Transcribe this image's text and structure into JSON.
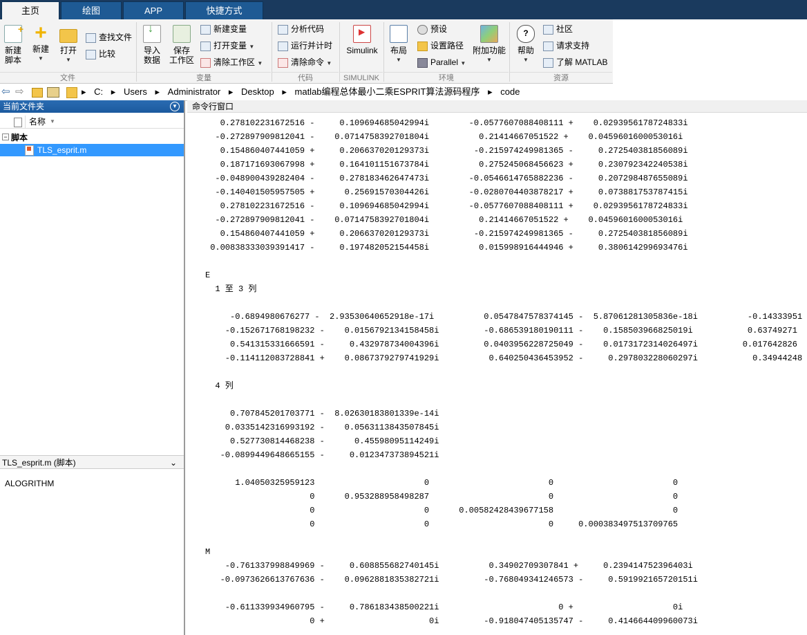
{
  "tabs": [
    "主页",
    "绘图",
    "APP",
    "快捷方式"
  ],
  "ribbon": {
    "file": {
      "new_script": "新建\n脚本",
      "new": "新建",
      "open": "打开",
      "find_files": "查找文件",
      "compare": "比较",
      "group": "文件"
    },
    "variable": {
      "import": "导入\n数据",
      "save_ws": "保存\n工作区",
      "new_var": "新建变量",
      "open_var": "打开变量",
      "clear_ws": "清除工作区",
      "group": "变量"
    },
    "code": {
      "analyze": "分析代码",
      "run_time": "运行并计时",
      "clear_cmd": "清除命令",
      "group": "代码"
    },
    "simulink": {
      "simulink": "Simulink",
      "group": "SIMULINK"
    },
    "env": {
      "layout": "布局",
      "prefs": "预设",
      "set_path": "设置路径",
      "parallel": "Parallel",
      "addons": "附加功能",
      "group": "环境"
    },
    "resources": {
      "help": "帮助",
      "community": "社区",
      "support": "请求支持",
      "learn": "了解 MATLAB",
      "group": "资源"
    }
  },
  "address": {
    "path": [
      "C:",
      "Users",
      "Administrator",
      "Desktop",
      "matlab编程总体最小二乘ESPRIT算法源码程序",
      "code"
    ]
  },
  "left": {
    "title": "当前文件夹",
    "col_name": "名称",
    "folder": "脚本",
    "file": "TLS_esprit.m",
    "details_title": "TLS_esprit.m  (脚本)",
    "details_body": "ALOGRITHM"
  },
  "command": {
    "title": "命令行窗口",
    "lines": [
      "   0.278102231672516 -     0.109694685042994i        -0.0577607088408111 +    0.0293956178724833i",
      "  -0.272897909812041 -    0.0714758392701804i          0.21414667051522 +    0.0459601600053016i",
      "   0.154860407441059 +     0.206637020129373i         -0.215974249981365 -     0.272540381856089i",
      "   0.187171693067998 +     0.164101151673784i          0.275245068456623 +     0.230792342240538i",
      "  -0.048900439282404 -     0.278183462647473i        -0.0546614765882236 -     0.207298487655089i",
      "  -0.140401505957505 +      0.25691570304426i        -0.0280704403878217 +     0.073881753787415i",
      "   0.278102231672516 -     0.109694685042994i        -0.0577607088408111 +    0.0293956178724833i",
      "  -0.272897909812041 -    0.0714758392701804i          0.21414667051522 +    0.0459601600053016i",
      "   0.154860407441059 +     0.206637020129373i         -0.215974249981365 -     0.272540381856089i",
      " 0.00838333039391417 -     0.197482052154458i          0.015998916444946 +     0.380614299693476i",
      "",
      "E",
      "  1 至 3 列",
      "",
      "     -0.6894980676277 -  2.93530640652918e-17i          0.0547847578374145 -  5.87061281305836e-18i          -0.14333951",
      "    -0.152671768198232 -    0.0156792134158458i         -0.686539180190111 -    0.158503966825019i           0.63749271",
      "     0.541315331666591 -     0.432978734004396i         0.0403956228725049 -    0.0173172314026497i         0.017642826",
      "    -0.114112083728841 +    0.0867379279741929i          0.640250436453952 -     0.297803228060297i           0.34944248",
      "",
      "  4 列",
      "",
      "     0.707845201703771 -  8.02630183801339e-14i",
      "    0.0335142316993192 -    0.0563113843507845i",
      "     0.527730814468238 -      0.45598095114249i",
      "   -0.0899449648665155 -     0.012347373894521i",
      "",
      "      1.04050325959123                      0                        0                        0",
      "                     0      0.953288958498287                        0                        0",
      "                     0                      0      0.00582428439677158                        0",
      "                     0                      0                        0     0.000383497513709765",
      "",
      "M",
      "    -0.761337998849969 -     0.608855682740145i          0.34902709307841 +     0.239414752396403i",
      "   -0.0973626613767636 -    0.0962881835382721i         -0.768049341246573 -     0.591992165720151i",
      "",
      "    -0.611339934960795 -     0.786183438500221i                        0 +                    0i",
      "                     0 +                     0i         -0.918047405135747 -     0.414664409960073i"
    ]
  }
}
